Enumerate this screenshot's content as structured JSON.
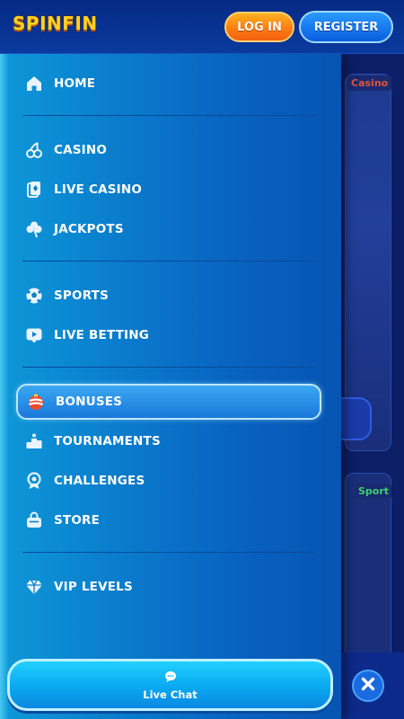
{
  "header": {
    "logo": "SPINFIN",
    "login_label": "LOG IN",
    "register_label": "REGISTER"
  },
  "background": {
    "casino_tag": "Casino",
    "sport_tag": "Sport"
  },
  "menu": {
    "items": [
      {
        "label": "HOME",
        "icon": "home-icon"
      },
      {
        "label": "CASINO",
        "icon": "cherries-icon"
      },
      {
        "label": "LIVE CASINO",
        "icon": "playing-card-icon"
      },
      {
        "label": "JACKPOTS",
        "icon": "clover-icon"
      },
      {
        "label": "SPORTS",
        "icon": "soccer-ball-icon"
      },
      {
        "label": "LIVE BETTING",
        "icon": "play-screen-icon"
      },
      {
        "label": "BONUSES",
        "icon": "bonus-ball-icon",
        "active": true
      },
      {
        "label": "TOURNAMENTS",
        "icon": "podium-icon"
      },
      {
        "label": "CHALLENGES",
        "icon": "medal-icon"
      },
      {
        "label": "STORE",
        "icon": "shopping-bag-icon"
      },
      {
        "label": "VIP LEVELS",
        "icon": "diamond-icon"
      }
    ]
  },
  "chat": {
    "label": "Live Chat",
    "icon": "chat-bubble-icon"
  },
  "close": {
    "icon": "close-icon"
  },
  "colors": {
    "drawer": "#0a7ccc",
    "accent_orange": "#ff7a10",
    "accent_blue": "#0a5ee0",
    "active_item": "#1a78dc"
  }
}
